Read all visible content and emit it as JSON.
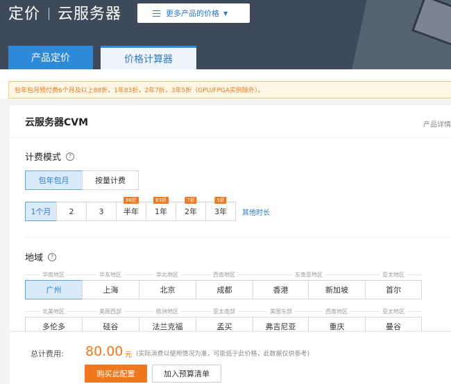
{
  "header": {
    "title_left": "定价",
    "title_right": "云服务器",
    "more_products_label": "更多产品的价格",
    "tabs": [
      {
        "label": "产品定价"
      },
      {
        "label": "价格计算器"
      }
    ]
  },
  "notice": "包年包月预付费6个月及以上88折，1年83折，2年7折，3年5折（GPU/FPGA实例除外）。",
  "product": {
    "name": "云服务器CVM",
    "detail_link": "产品详情"
  },
  "billing": {
    "label": "计费模式",
    "help_icon": "?",
    "options": [
      {
        "label": "包年包月",
        "selected": true
      },
      {
        "label": "按量计费",
        "selected": false
      }
    ]
  },
  "duration": {
    "options": [
      {
        "label": "1个月",
        "badge": "",
        "selected": true
      },
      {
        "label": "2",
        "badge": "",
        "selected": false
      },
      {
        "label": "3",
        "badge": "",
        "selected": false
      },
      {
        "label": "半年",
        "badge": "88折",
        "selected": false
      },
      {
        "label": "1年",
        "badge": "83折",
        "selected": false
      },
      {
        "label": "2年",
        "badge": "7折",
        "selected": false
      },
      {
        "label": "3年",
        "badge": "5折",
        "selected": false
      }
    ],
    "other_label": "其他时长"
  },
  "region": {
    "label": "地域",
    "help_icon": "?",
    "row1_groups": [
      "华南地区",
      "华东地区",
      "华北地区",
      "西南地区",
      "东南亚地区",
      "亚太地区"
    ],
    "row1_cities": [
      "广州",
      "上海",
      "北京",
      "成都",
      "香港",
      "新加坡",
      "首尔"
    ],
    "row2_groups": [
      "北美地区",
      "美国西部",
      "欧洲地区",
      "亚太南部",
      "美国东部",
      "西南地区",
      "亚太地区"
    ],
    "row2_cities": [
      "多伦多",
      "硅谷",
      "法兰克福",
      "孟买",
      "弗吉尼亚",
      "重庆",
      "曼谷"
    ],
    "selected_city": "广州"
  },
  "footer": {
    "total_label": "总计费用:",
    "price": "80.00",
    "unit": "元",
    "note": "(实际消费以使用情况为准，可能低于此价格，此数据仅供参考)",
    "buy_label": "购买此配置",
    "budget_label": "加入预算清单"
  },
  "colors": {
    "accent": "#2c8ad8",
    "orange": "#f0771c",
    "header_bg": "#3e4a59"
  }
}
